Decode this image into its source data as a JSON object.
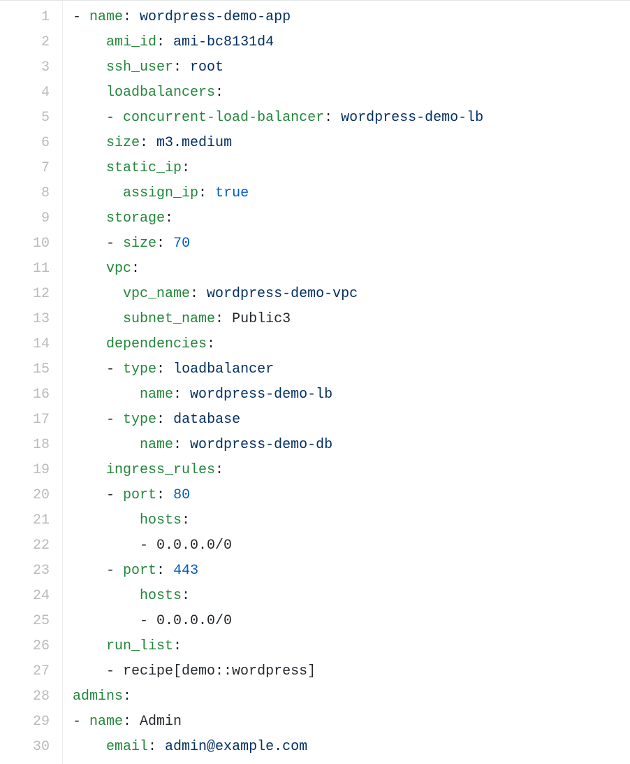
{
  "colors": {
    "key": "#22863a",
    "string": "#032f62",
    "number": "#005cc5",
    "plain": "#24292e",
    "gutter": "#babbbc"
  },
  "lines": [
    {
      "n": 1,
      "tokens": [
        {
          "t": "- ",
          "c": "punct"
        },
        {
          "t": "name",
          "c": "key"
        },
        {
          "t": ": ",
          "c": "punct"
        },
        {
          "t": "wordpress-demo-app",
          "c": "str"
        }
      ],
      "indent": 0
    },
    {
      "n": 2,
      "tokens": [
        {
          "t": "ami_id",
          "c": "key"
        },
        {
          "t": ": ",
          "c": "punct"
        },
        {
          "t": "ami-bc8131d4",
          "c": "str"
        }
      ],
      "indent": 2
    },
    {
      "n": 3,
      "tokens": [
        {
          "t": "ssh_user",
          "c": "key"
        },
        {
          "t": ": ",
          "c": "punct"
        },
        {
          "t": "root",
          "c": "str"
        }
      ],
      "indent": 2
    },
    {
      "n": 4,
      "tokens": [
        {
          "t": "loadbalancers",
          "c": "key"
        },
        {
          "t": ":",
          "c": "punct"
        }
      ],
      "indent": 2
    },
    {
      "n": 5,
      "tokens": [
        {
          "t": "- ",
          "c": "punct"
        },
        {
          "t": "concurrent-load-balancer",
          "c": "key"
        },
        {
          "t": ": ",
          "c": "punct"
        },
        {
          "t": "wordpress-demo-lb",
          "c": "str"
        }
      ],
      "indent": 2
    },
    {
      "n": 6,
      "tokens": [
        {
          "t": "size",
          "c": "key"
        },
        {
          "t": ": ",
          "c": "punct"
        },
        {
          "t": "m3.medium",
          "c": "str"
        }
      ],
      "indent": 2
    },
    {
      "n": 7,
      "tokens": [
        {
          "t": "static_ip",
          "c": "key"
        },
        {
          "t": ":",
          "c": "punct"
        }
      ],
      "indent": 2
    },
    {
      "n": 8,
      "tokens": [
        {
          "t": "assign_ip",
          "c": "key"
        },
        {
          "t": ": ",
          "c": "punct"
        },
        {
          "t": "true",
          "c": "bool"
        }
      ],
      "indent": 3
    },
    {
      "n": 9,
      "tokens": [
        {
          "t": "storage",
          "c": "key"
        },
        {
          "t": ":",
          "c": "punct"
        }
      ],
      "indent": 2
    },
    {
      "n": 10,
      "tokens": [
        {
          "t": "- ",
          "c": "punct"
        },
        {
          "t": "size",
          "c": "key"
        },
        {
          "t": ": ",
          "c": "punct"
        },
        {
          "t": "70",
          "c": "num"
        }
      ],
      "indent": 2
    },
    {
      "n": 11,
      "tokens": [
        {
          "t": "vpc",
          "c": "key"
        },
        {
          "t": ":",
          "c": "punct"
        }
      ],
      "indent": 2
    },
    {
      "n": 12,
      "tokens": [
        {
          "t": "vpc_name",
          "c": "key"
        },
        {
          "t": ": ",
          "c": "punct"
        },
        {
          "t": "wordpress-demo-vpc",
          "c": "str"
        }
      ],
      "indent": 3
    },
    {
      "n": 13,
      "tokens": [
        {
          "t": "subnet_name",
          "c": "key"
        },
        {
          "t": ": ",
          "c": "punct"
        },
        {
          "t": "Public3",
          "c": "plain"
        }
      ],
      "indent": 3
    },
    {
      "n": 14,
      "tokens": [
        {
          "t": "dependencies",
          "c": "key"
        },
        {
          "t": ":",
          "c": "punct"
        }
      ],
      "indent": 2
    },
    {
      "n": 15,
      "tokens": [
        {
          "t": "- ",
          "c": "punct"
        },
        {
          "t": "type",
          "c": "key"
        },
        {
          "t": ": ",
          "c": "punct"
        },
        {
          "t": "loadbalancer",
          "c": "str"
        }
      ],
      "indent": 2
    },
    {
      "n": 16,
      "tokens": [
        {
          "t": "name",
          "c": "key"
        },
        {
          "t": ": ",
          "c": "punct"
        },
        {
          "t": "wordpress-demo-lb",
          "c": "str"
        }
      ],
      "indent": 4
    },
    {
      "n": 17,
      "tokens": [
        {
          "t": "- ",
          "c": "punct"
        },
        {
          "t": "type",
          "c": "key"
        },
        {
          "t": ": ",
          "c": "punct"
        },
        {
          "t": "database",
          "c": "str"
        }
      ],
      "indent": 2
    },
    {
      "n": 18,
      "tokens": [
        {
          "t": "name",
          "c": "key"
        },
        {
          "t": ": ",
          "c": "punct"
        },
        {
          "t": "wordpress-demo-db",
          "c": "str"
        }
      ],
      "indent": 4
    },
    {
      "n": 19,
      "tokens": [
        {
          "t": "ingress_rules",
          "c": "key"
        },
        {
          "t": ":",
          "c": "punct"
        }
      ],
      "indent": 2
    },
    {
      "n": 20,
      "tokens": [
        {
          "t": "- ",
          "c": "punct"
        },
        {
          "t": "port",
          "c": "key"
        },
        {
          "t": ": ",
          "c": "punct"
        },
        {
          "t": "80",
          "c": "num"
        }
      ],
      "indent": 2
    },
    {
      "n": 21,
      "tokens": [
        {
          "t": "hosts",
          "c": "key"
        },
        {
          "t": ":",
          "c": "punct"
        }
      ],
      "indent": 4
    },
    {
      "n": 22,
      "tokens": [
        {
          "t": "- ",
          "c": "punct"
        },
        {
          "t": "0.0.0.0/0",
          "c": "plain"
        }
      ],
      "indent": 4
    },
    {
      "n": 23,
      "tokens": [
        {
          "t": "- ",
          "c": "punct"
        },
        {
          "t": "port",
          "c": "key"
        },
        {
          "t": ": ",
          "c": "punct"
        },
        {
          "t": "443",
          "c": "num"
        }
      ],
      "indent": 2
    },
    {
      "n": 24,
      "tokens": [
        {
          "t": "hosts",
          "c": "key"
        },
        {
          "t": ":",
          "c": "punct"
        }
      ],
      "indent": 4
    },
    {
      "n": 25,
      "tokens": [
        {
          "t": "- ",
          "c": "punct"
        },
        {
          "t": "0.0.0.0/0",
          "c": "plain"
        }
      ],
      "indent": 4
    },
    {
      "n": 26,
      "tokens": [
        {
          "t": "run_list",
          "c": "key"
        },
        {
          "t": ":",
          "c": "punct"
        }
      ],
      "indent": 2
    },
    {
      "n": 27,
      "tokens": [
        {
          "t": "- ",
          "c": "punct"
        },
        {
          "t": "recipe[demo::wordpress]",
          "c": "plain"
        }
      ],
      "indent": 2
    },
    {
      "n": 28,
      "tokens": [
        {
          "t": "admins",
          "c": "key"
        },
        {
          "t": ":",
          "c": "punct"
        }
      ],
      "indent": 0
    },
    {
      "n": 29,
      "tokens": [
        {
          "t": "- ",
          "c": "punct"
        },
        {
          "t": "name",
          "c": "key"
        },
        {
          "t": ": ",
          "c": "punct"
        },
        {
          "t": "Admin",
          "c": "plain"
        }
      ],
      "indent": 0
    },
    {
      "n": 30,
      "tokens": [
        {
          "t": "email",
          "c": "key"
        },
        {
          "t": ": ",
          "c": "punct"
        },
        {
          "t": "admin@example.com",
          "c": "str"
        }
      ],
      "indent": 2
    }
  ]
}
